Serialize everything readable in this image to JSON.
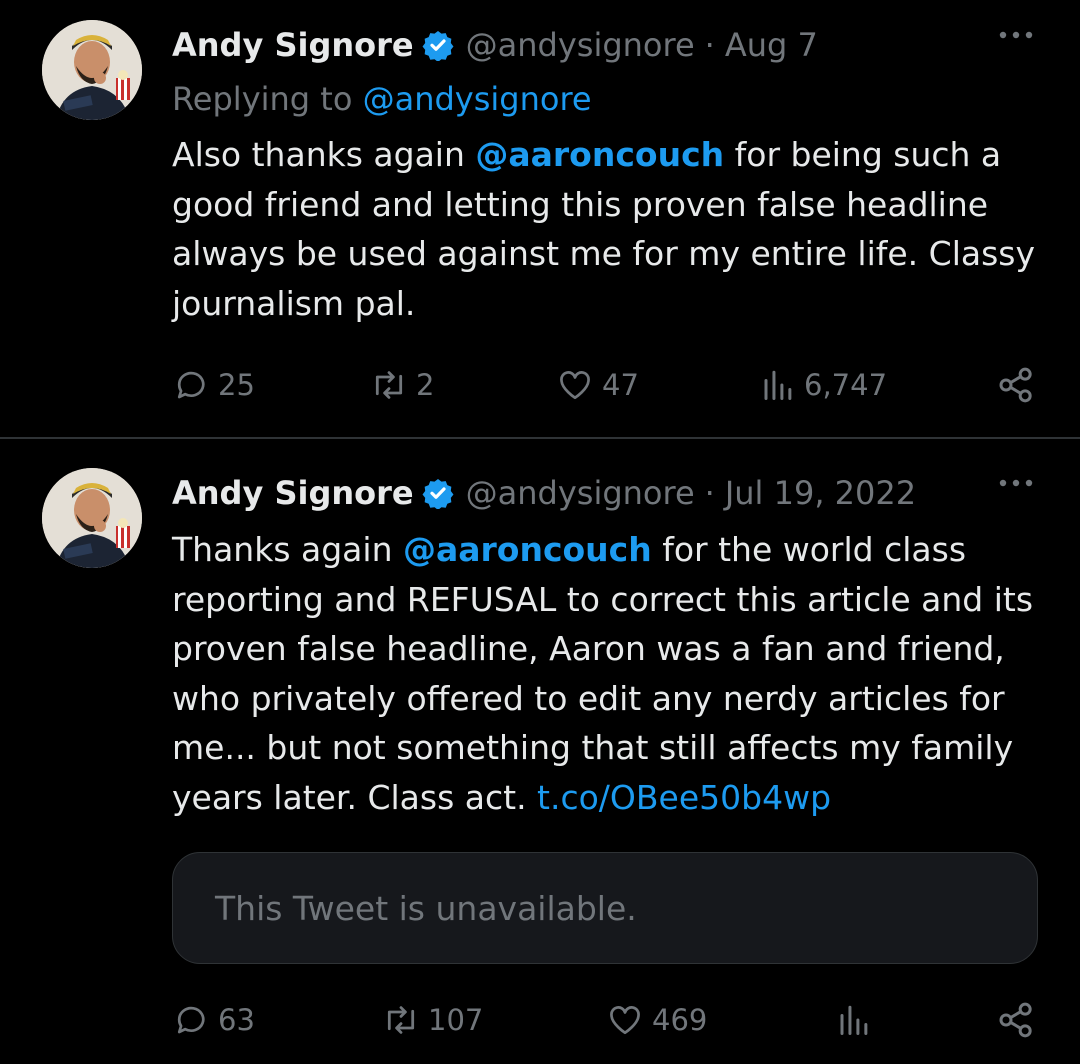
{
  "tweets": [
    {
      "author": {
        "name": "Andy Signore",
        "handle": "@andysignore",
        "verified": true,
        "avatar": "avatar-photo"
      },
      "separator": "·",
      "date": "Aug 7",
      "replying_prefix": "Replying to ",
      "replying_to": "@andysignore",
      "body": {
        "p1": "Also thanks again ",
        "mention": "@aaroncouch",
        "p2": " for being such a good friend and letting this proven false headline always be used against me for my entire life. Classy journalism pal."
      },
      "stats": {
        "replies": "25",
        "retweets": "2",
        "likes": "47",
        "views": "6,747"
      }
    },
    {
      "author": {
        "name": "Andy Signore",
        "handle": "@andysignore",
        "verified": true,
        "avatar": "avatar-photo"
      },
      "separator": "·",
      "date": "Jul 19, 2022",
      "body": {
        "p1": "Thanks again ",
        "mention": "@aaroncouch",
        "p2": " for the world class reporting and REFUSAL to correct this article and its proven false headline, Aaron was a fan and friend, who privately offered to edit any nerdy articles for me... but not something that still affects my family years later. Class act. ",
        "link": "t.co/OBee50b4wp"
      },
      "quoted": {
        "text": "This Tweet is unavailable."
      },
      "stats": {
        "replies": "63",
        "retweets": "107",
        "likes": "469",
        "views": ""
      }
    }
  ],
  "icons": {
    "verified": "verified-badge-icon",
    "more": "more-dots-icon",
    "reply": "reply-bubble-icon",
    "retweet": "retweet-icon",
    "like": "heart-icon",
    "views": "views-bar-chart-icon",
    "share": "share-icon"
  },
  "colors": {
    "background": "#000000",
    "text": "#e7e9ea",
    "secondary": "#71767b",
    "accent": "#1d9bf0",
    "divider": "#2f3336",
    "quote_bg": "#16181c"
  }
}
